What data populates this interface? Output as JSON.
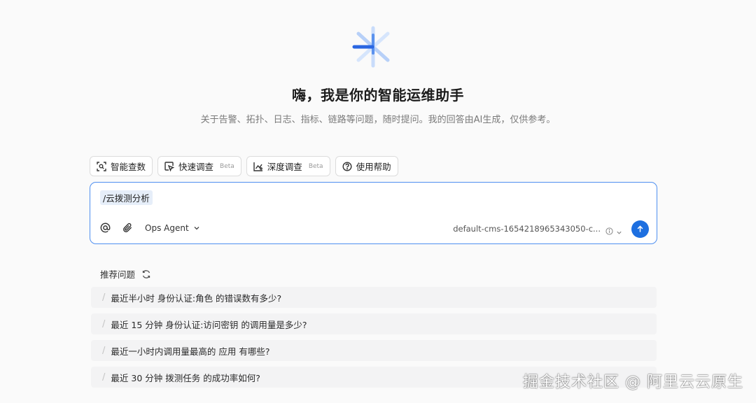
{
  "hero": {
    "title": "嗨，我是你的智能运维助手",
    "subtitle": "关于告警、拓扑、日志、指标、链路等问题，随时提问。我的回答由AI生成，仅供参考。"
  },
  "quick_actions": [
    {
      "label": "智能查数",
      "icon": "scan-search-icon"
    },
    {
      "label": "快速调查",
      "badge": "Beta",
      "icon": "cursor-click-icon"
    },
    {
      "label": "深度调查",
      "badge": "Beta",
      "icon": "chart-analysis-icon"
    },
    {
      "label": "使用帮助",
      "icon": "help-circle-icon"
    }
  ],
  "composer": {
    "command": "/云拨测分析",
    "agent": "Ops Agent",
    "workspace": "default-cms-1654218965343050-c...",
    "send_icon": "arrow-up-icon",
    "accent": "#1d6fe0"
  },
  "recommendations": {
    "title": "推荐问题",
    "items": [
      "最近半小时 身份认证:角色 的错误数有多少?",
      "最近 15 分钟 身份认证:访问密钥 的调用量是多少?",
      "最近一小时内调用量最高的 应用 有哪些?",
      "最近 30 分钟 拨测任务 的成功率如何?"
    ]
  },
  "watermark": "掘金技术社区 @ 阿里云云原生"
}
